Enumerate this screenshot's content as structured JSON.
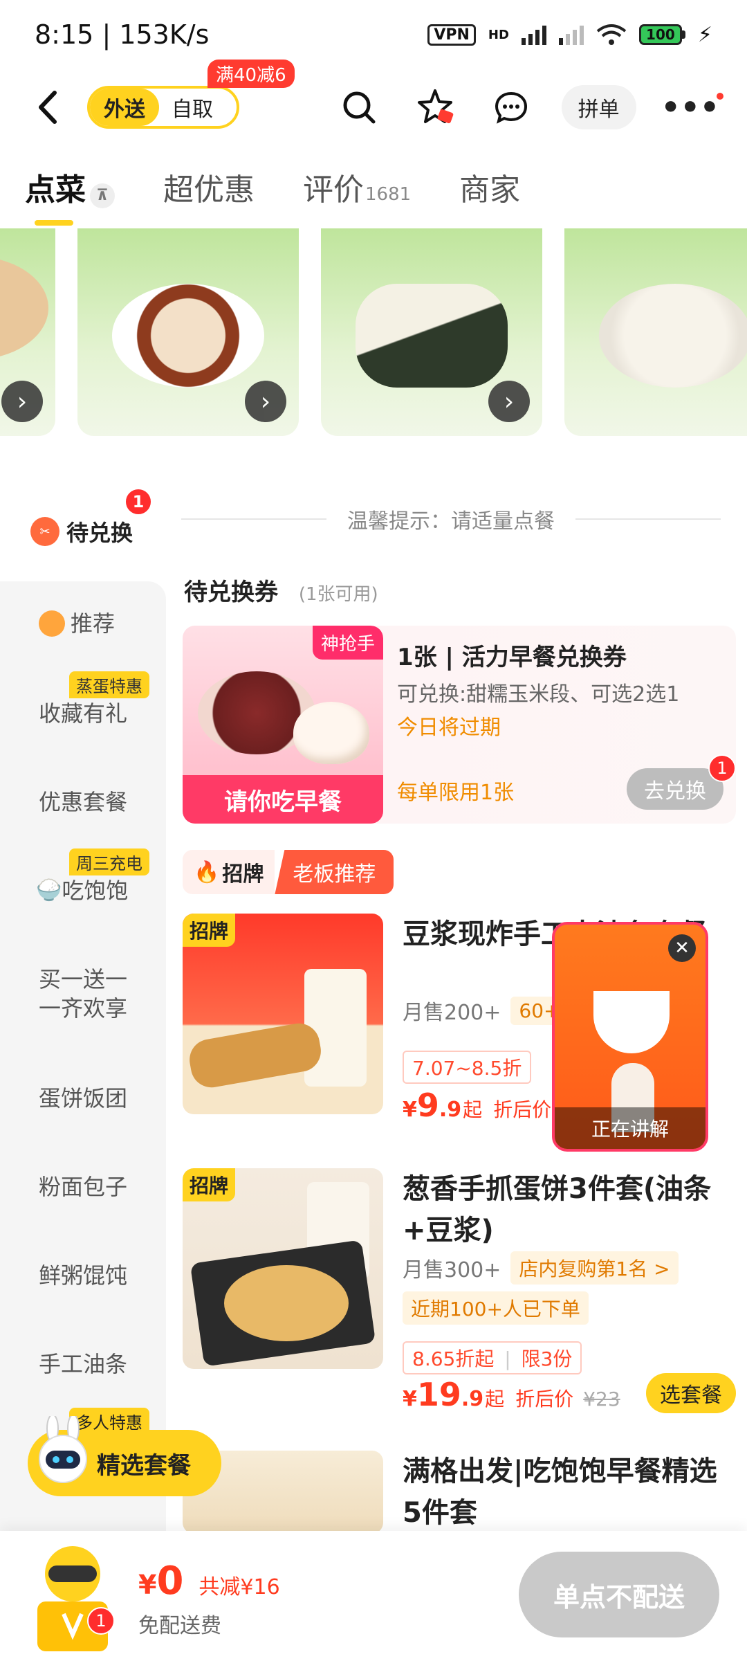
{
  "status_bar": {
    "time": "8:15",
    "speed": "153K/s",
    "vpn": "VPN",
    "hd": "HD",
    "battery": "100"
  },
  "nav": {
    "delivery": "外送",
    "pickup": "自取",
    "promo": "满40减6",
    "group_order": "拼单"
  },
  "tabs": [
    {
      "label": "点菜"
    },
    {
      "label": "超优惠"
    },
    {
      "label": "评价",
      "count": "1681"
    },
    {
      "label": "商家"
    }
  ],
  "hint": "温馨提示：请适量点餐",
  "categories": {
    "redeem": "待兑换",
    "redeem_badge": "1",
    "items": [
      {
        "label": "推荐"
      },
      {
        "label": "收藏有礼",
        "tag": "蒸蛋特惠"
      },
      {
        "label": "优惠套餐"
      },
      {
        "label": "吃饱饱",
        "tag": "周三充电"
      },
      {
        "label": "买一送一 一齐欢享"
      },
      {
        "label": "蛋饼饭团"
      },
      {
        "label": "粉面包子"
      },
      {
        "label": "鲜粥馄饨"
      },
      {
        "label": "手工油条"
      }
    ],
    "multi_tag": "多人特惠"
  },
  "voucher_section": {
    "title": "待兑换券",
    "subtitle": "(1张可用)",
    "image_tag": "神抢手",
    "image_band": "请你吃早餐",
    "line1": "1张 | 活力早餐兑换券",
    "line2": "可兑换:甜糯玉米段、可选2选1",
    "line3": "今日将过期",
    "line4": "每单限用1张",
    "button": "去兑换",
    "button_badge": "1"
  },
  "signature": {
    "left": "招牌",
    "right": "老板推荐"
  },
  "products": [
    {
      "tag": "招牌",
      "name": "豆浆现炸手工大油条套餐",
      "sales": "月售200+",
      "chip": "60+",
      "discount": "7.07~8.5折",
      "price_int": "9",
      "price_dec": ".9",
      "price_suffix": "起",
      "after": "折后价"
    },
    {
      "tag": "招牌",
      "name": "葱香手抓蛋饼3件套(油条+豆浆)",
      "sales": "月售300+",
      "chip": "店内复购第1名 >",
      "chip2": "近期100+人已下单",
      "discount": "8.65折起",
      "limit": "限3份",
      "price_int": "19",
      "price_dec": ".9",
      "price_suffix": "起",
      "after": "折后价",
      "orig": "¥23",
      "button": "选套餐"
    },
    {
      "name": "满格出发|吃饱饱早餐精选5件套"
    }
  ],
  "live": {
    "label": "正在讲解"
  },
  "floating": {
    "label": "精选套餐"
  },
  "bottom": {
    "currency": "¥",
    "amount": "0",
    "saved": "共减¥16",
    "fee": "免配送费",
    "cart_badge": "1",
    "submit": "单点不配送"
  },
  "colors": {
    "brand_yellow": "#ffd21f",
    "price_red": "#ff3b1f",
    "orange": "#f08c00"
  }
}
